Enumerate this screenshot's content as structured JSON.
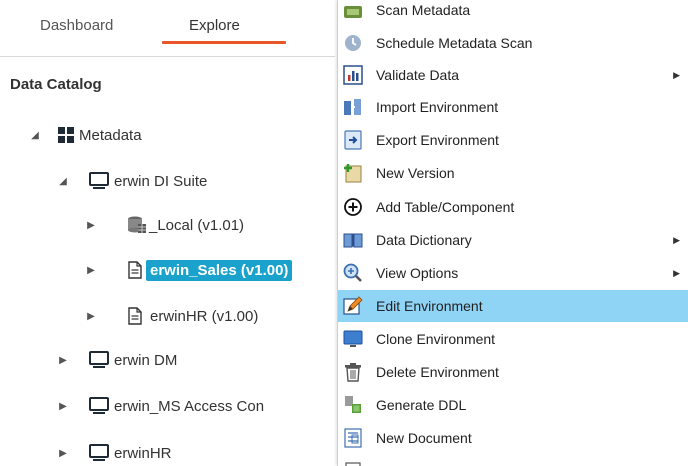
{
  "tabs": {
    "dashboard": "Dashboard",
    "explore": "Explore"
  },
  "panel": {
    "title": "Data Catalog"
  },
  "tree": {
    "metadata": "Metadata",
    "di_suite": "erwin DI Suite",
    "local": "_Local (v1.01)",
    "sales": "erwin_Sales (v1.00)",
    "hr_version": "erwinHR (v1.00)",
    "dm": "erwin DM",
    "ms_access": "erwin_MS Access Con",
    "erwinhr": "erwinHR"
  },
  "menu": {
    "items": [
      {
        "label": "Scan Metadata",
        "icon": "scan-icon"
      },
      {
        "label": "Schedule Metadata Scan",
        "icon": "clock-icon"
      },
      {
        "label": "Validate Data",
        "icon": "chart-icon",
        "submenu": true
      },
      {
        "label": "Import Environment",
        "icon": "import-icon"
      },
      {
        "label": "Export Environment",
        "icon": "export-icon"
      },
      {
        "label": "New Version",
        "icon": "new-version-icon"
      },
      {
        "label": "Add Table/Component",
        "icon": "plus-circle-icon"
      },
      {
        "label": "Data Dictionary",
        "icon": "book-icon",
        "submenu": true
      },
      {
        "label": "View Options",
        "icon": "magnifier-icon",
        "submenu": true
      },
      {
        "label": "Edit Environment",
        "icon": "edit-icon",
        "active": true
      },
      {
        "label": "Clone Environment",
        "icon": "monitor-icon"
      },
      {
        "label": "Delete Environment",
        "icon": "trash-icon"
      },
      {
        "label": "Generate DDL",
        "icon": "ddl-icon"
      },
      {
        "label": "New Document",
        "icon": "document-icon"
      }
    ]
  },
  "colors": {
    "accent_underline": "#e8562a",
    "selected_node": "#1aa1cc",
    "menu_highlight": "#8fd3f5"
  }
}
